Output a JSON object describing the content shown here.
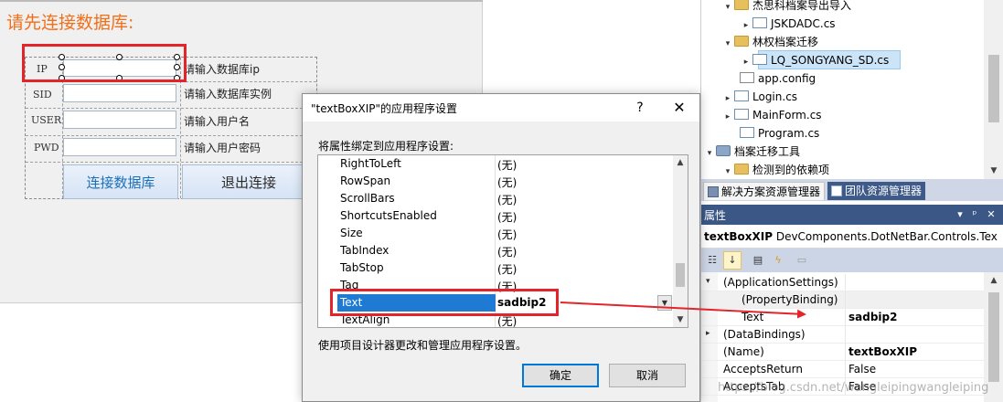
{
  "designer": {
    "title": "请先连接数据库:",
    "fields": [
      {
        "label": "IP",
        "hint": "请输入数据库ip",
        "value": ""
      },
      {
        "label": "SID",
        "hint": "请输入数据库实例",
        "value": ""
      },
      {
        "label": "USER",
        "hint": "请输入用户名",
        "value": ""
      },
      {
        "label": "PWD",
        "hint": "请输入用户密码",
        "value": ""
      }
    ],
    "connect_label": "连接数据库",
    "exit_label": "退出连接"
  },
  "dialog": {
    "title": "\"textBoxXIP\"的应用程序设置",
    "help_glyph": "?",
    "close_glyph": "✕",
    "bind_label": "将属性绑定到应用程序设置:",
    "rows": [
      {
        "name": "RightToLeft",
        "value": "(无)"
      },
      {
        "name": "RowSpan",
        "value": "(无)"
      },
      {
        "name": "ScrollBars",
        "value": "(无)"
      },
      {
        "name": "ShortcutsEnabled",
        "value": "(无)"
      },
      {
        "name": "Size",
        "value": "(无)"
      },
      {
        "name": "TabIndex",
        "value": "(无)"
      },
      {
        "name": "TabStop",
        "value": "(无)"
      },
      {
        "name": "Tag",
        "value": "(无)"
      },
      {
        "name": "Text",
        "value": "sadbip2"
      },
      {
        "name": "TextAlign",
        "value": "(无)"
      }
    ],
    "selected_row": "Text",
    "footer_text": "使用项目设计器更改和管理应用程序设置。",
    "ok_label": "确定",
    "cancel_label": "取消"
  },
  "solution_tree": {
    "items": [
      {
        "label": "杰思科档案导出导入",
        "kind": "folder",
        "expanded": true
      },
      {
        "label": "JSKDADC.cs",
        "kind": "cs",
        "expanded": false
      },
      {
        "label": "林权档案迁移",
        "kind": "folder",
        "expanded": true
      },
      {
        "label": "LQ_SONGYANG_SD.cs",
        "kind": "cs",
        "expanded": false,
        "selected": true
      },
      {
        "label": "app.config",
        "kind": "config"
      },
      {
        "label": "Login.cs",
        "kind": "cs",
        "expanded": false
      },
      {
        "label": "MainForm.cs",
        "kind": "cs",
        "expanded": false
      },
      {
        "label": "Program.cs",
        "kind": "cs"
      },
      {
        "label": "档案迁移工具",
        "kind": "project",
        "expanded": true
      },
      {
        "label": "检测到的依赖项",
        "kind": "folder",
        "expanded": true
      }
    ]
  },
  "panel_tabs": {
    "solution_explorer": "解决方案资源管理器",
    "team_explorer": "团队资源管理器"
  },
  "properties": {
    "header_title": "属性",
    "header_pin": "▾ ᵖ ✕",
    "object_name": "textBoxXIP",
    "object_type": "DevComponents.DotNetBar.Controls.Tex",
    "grid": [
      {
        "name": "(ApplicationSettings)",
        "value": "",
        "indent": 0,
        "arrow": "▾",
        "bold_value": false
      },
      {
        "name": "(PropertyBinding)",
        "value": "",
        "indent": 1,
        "arrow": "",
        "bold_value": false
      },
      {
        "name": "Text",
        "value": "sadbip2",
        "indent": 1,
        "arrow": "",
        "bold_value": true
      },
      {
        "name": "(DataBindings)",
        "value": "",
        "indent": 0,
        "arrow": "▸",
        "bold_value": false
      },
      {
        "name": "(Name)",
        "value": "textBoxXIP",
        "indent": 0,
        "arrow": "",
        "bold_value": true
      },
      {
        "name": "AcceptsReturn",
        "value": "False",
        "indent": 0,
        "arrow": "",
        "bold_value": false
      },
      {
        "name": "AcceptsTab",
        "value": "False",
        "indent": 0,
        "arrow": "",
        "bold_value": false
      }
    ]
  },
  "watermark": "https://blog.csdn.net/wangleipingwangleiping",
  "colors": {
    "accent_orange": "#f26f1a",
    "annotation_red": "#e3242b",
    "selection_blue": "#1e7ad3",
    "vs_header_blue": "#3a5785"
  }
}
